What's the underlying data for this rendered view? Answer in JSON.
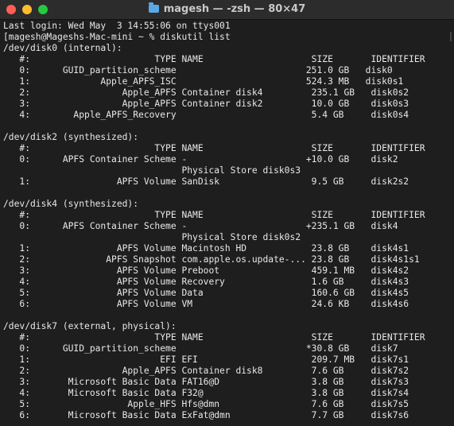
{
  "window": {
    "title": "magesh — -zsh — 80×47",
    "folder_icon": "folder-icon"
  },
  "terminal": {
    "lines": [
      "Last login: Wed May  3 14:55:06 on ttys001",
      "[magesh@Mageshs-Mac-mini ~ % diskutil list",
      "/dev/disk0 (internal):",
      "   #:                       TYPE NAME                    SIZE       IDENTIFIER",
      "   0:      GUID_partition_scheme                        251.0 GB   disk0",
      "   1:             Apple_APFS_ISC                        524.3 MB   disk0s1",
      "   2:                 Apple_APFS Container disk4         235.1 GB   disk0s2",
      "   3:                 Apple_APFS Container disk2         10.0 GB    disk0s3",
      "   4:        Apple_APFS_Recovery                         5.4 GB     disk0s4",
      "",
      "/dev/disk2 (synthesized):",
      "   #:                       TYPE NAME                    SIZE       IDENTIFIER",
      "   0:      APFS Container Scheme -                      +10.0 GB    disk2",
      "                                 Physical Store disk0s3",
      "   1:                APFS Volume SanDisk                 9.5 GB     disk2s2",
      "",
      "/dev/disk4 (synthesized):",
      "   #:                       TYPE NAME                    SIZE       IDENTIFIER",
      "   0:      APFS Container Scheme -                      +235.1 GB   disk4",
      "                                 Physical Store disk0s2",
      "   1:                APFS Volume Macintosh HD            23.8 GB    disk4s1",
      "   2:              APFS Snapshot com.apple.os.update-... 23.8 GB    disk4s1s1",
      "   3:                APFS Volume Preboot                 459.1 MB   disk4s2",
      "   4:                APFS Volume Recovery                1.6 GB     disk4s3",
      "   5:                APFS Volume Data                    160.6 GB   disk4s5",
      "   6:                APFS Volume VM                      24.6 KB    disk4s6",
      "",
      "/dev/disk7 (external, physical):",
      "   #:                       TYPE NAME                    SIZE       IDENTIFIER",
      "   0:      GUID_partition_scheme                        *30.8 GB    disk7",
      "   1:                        EFI EFI                     209.7 MB   disk7s1",
      "   2:                 Apple_APFS Container disk8         7.6 GB     disk7s2",
      "   3:       Microsoft Basic Data FAT16@D                 3.8 GB     disk7s3",
      "   4:       Microsoft Basic Data F32@                    3.8 GB     disk7s4",
      "   5:                  Apple_HFS Hfs@dmn                 7.6 GB     disk7s5",
      "   6:       Microsoft Basic Data ExFat@dmn               7.7 GB     disk7s6"
    ]
  }
}
